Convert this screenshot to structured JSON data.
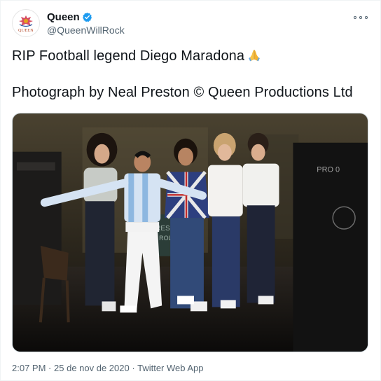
{
  "account": {
    "display_name": "Queen",
    "handle": "@QueenWillRock",
    "avatar_label": "QUEEN",
    "verified": true,
    "verified_icon": "verified-badge-icon",
    "accent_color": "#1d9bf0"
  },
  "tweet": {
    "line1": "RIP Football legend Diego Maradona",
    "line1_emoji": "folded-hands-emoji",
    "line2": "Photograph by Neal Preston © Queen Productions Ltd"
  },
  "media": {
    "kind": "photo",
    "signage": [
      "PRO 0",
      "RES",
      "ROL"
    ]
  },
  "meta": {
    "time": "2:07 PM",
    "date": "25 de nov de 2020",
    "source": "Twitter Web App",
    "separator": "·"
  },
  "icons": {
    "more": "more-options-icon"
  }
}
